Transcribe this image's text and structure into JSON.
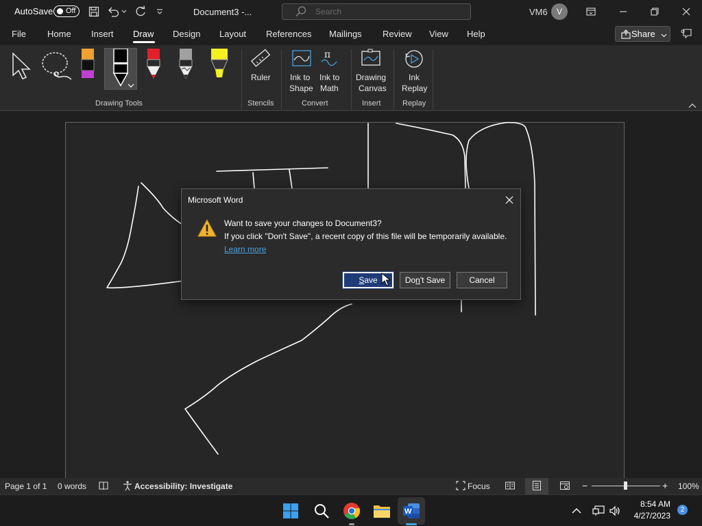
{
  "titlebar": {
    "autosave_label": "AutoSave",
    "autosave_state": "Off",
    "document_title": "Document3  -...",
    "search_placeholder": "Search",
    "user_name": "VM6",
    "avatar_initial": "V"
  },
  "tabs": [
    "File",
    "Home",
    "Insert",
    "Draw",
    "Design",
    "Layout",
    "References",
    "Mailings",
    "Review",
    "View",
    "Help"
  ],
  "active_tab": "Draw",
  "share_label": "Share",
  "ribbon": {
    "groups": {
      "drawing_tools": "Drawing Tools",
      "stencils": "Stencils",
      "convert": "Convert",
      "insert": "Insert",
      "replay": "Replay"
    },
    "buttons": {
      "ruler": "Ruler",
      "ink_to_shape_1": "Ink to",
      "ink_to_shape_2": "Shape",
      "ink_to_math_1": "Ink to",
      "ink_to_math_2": "Math",
      "drawing_canvas_1": "Drawing",
      "drawing_canvas_2": "Canvas",
      "ink_replay_1": "Ink",
      "ink_replay_2": "Replay"
    },
    "pen_colors": {
      "highlighter_orange": "#f0a030",
      "pen_black": "#000000",
      "pen_red": "#e0202a",
      "pencil_gray": "#a0a0a0",
      "highlighter_yellow": "#f5f020"
    }
  },
  "dialog": {
    "title": "Microsoft Word",
    "message_1": "Want to save your changes to Document3?",
    "message_2": "If you click \"Don't Save\", a recent copy of this file will be temporarily available.",
    "link": "Learn more",
    "save_prefix": "",
    "save_key": "S",
    "save_suffix": "ave",
    "dontsave_prefix": "Do",
    "dontsave_key": "n",
    "dontsave_suffix": "'t Save",
    "cancel": "Cancel"
  },
  "statusbar": {
    "page": "Page 1 of 1",
    "words": "0 words",
    "accessibility": "Accessibility: Investigate",
    "focus": "Focus",
    "zoom": "100%"
  },
  "taskbar": {
    "time": "8:54 AM",
    "date": "4/27/2023",
    "notification_count": "2"
  },
  "colors": {
    "accent_blue": "#1f3c77",
    "link_blue": "#4aa3df",
    "warning_yellow": "#f2b42a"
  }
}
